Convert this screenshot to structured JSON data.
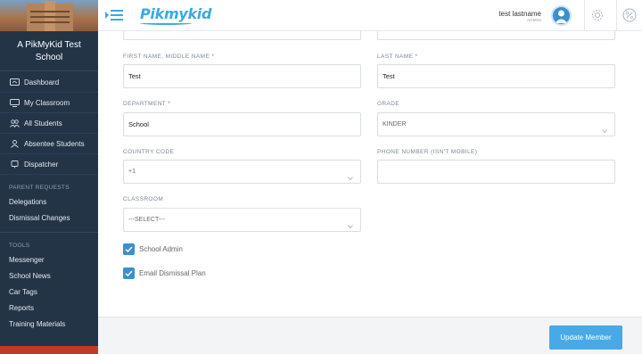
{
  "sidebar": {
    "school_name": "A PikMyKid Test School",
    "nav": [
      {
        "label": "Dashboard",
        "icon": "dashboard-icon"
      },
      {
        "label": "My Classroom",
        "icon": "classroom-icon"
      },
      {
        "label": "All Students",
        "icon": "students-icon"
      },
      {
        "label": "Absentee Students",
        "icon": "absentee-icon"
      },
      {
        "label": "Dispatcher",
        "icon": "dispatcher-icon"
      }
    ],
    "parent_requests_title": "PARENT REQUESTS",
    "parent_requests": [
      "Delegations",
      "Dismissal Changes"
    ],
    "tools_title": "TOOLS",
    "tools": [
      "Messenger",
      "School News",
      "Car Tags",
      "Reports",
      "Training Materials"
    ]
  },
  "header": {
    "logo": "Pikmykid",
    "user_name": "test lastname",
    "user_role": "ADMIN"
  },
  "form": {
    "first_name": {
      "label": "FIRST NAME, MIDDLE NAME *",
      "value": "Test"
    },
    "last_name": {
      "label": "LAST NAME *",
      "value": "Test"
    },
    "department": {
      "label": "DEPARTMENT *",
      "value": "School"
    },
    "grade": {
      "label": "GRADE",
      "value": "KINDER"
    },
    "country_code": {
      "label": "COUNTRY CODE",
      "value": "+1"
    },
    "phone": {
      "label": "PHONE NUMBER (ISN'T MOBILE)",
      "value": ""
    },
    "classroom": {
      "label": "CLASSROOM",
      "value": "---SELECT---"
    },
    "school_admin": {
      "label": "School Admin",
      "checked": true
    },
    "email_dismissal": {
      "label": "Email Dismissal Plan",
      "checked": true
    }
  },
  "footer": {
    "update_label": "Update Member"
  },
  "colors": {
    "sidebar_bg": "#243447",
    "accent": "#3a8fd0",
    "button": "#49a9e6"
  }
}
